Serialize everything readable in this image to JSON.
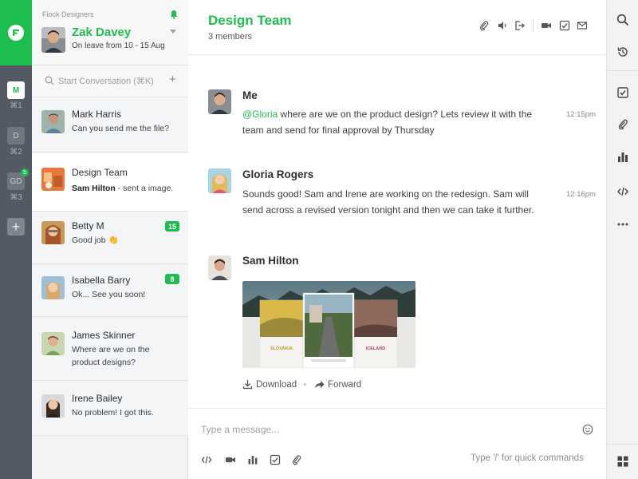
{
  "workspaces": [
    {
      "initial": "M",
      "shortcut": "⌘1"
    },
    {
      "initial": "D",
      "shortcut": "⌘2"
    },
    {
      "initial": "GD",
      "shortcut": "⌘3",
      "badge": "5"
    }
  ],
  "profile": {
    "org": "Flock Designers",
    "name": "Zak Davey",
    "status": "On leave from 10 - 15 Aug"
  },
  "search": {
    "placeholder": "Start Conversation (⌘K)"
  },
  "conversations": [
    {
      "name": "Mark Harris",
      "preview": "Can you send me the file?"
    },
    {
      "name": "Design Team",
      "preview_sender": "Sam Hilton",
      "preview": " - sent a image."
    },
    {
      "name": "Betty M",
      "preview": "Good job 👏",
      "badge": "15"
    },
    {
      "name": "Isabella Barry",
      "preview": "Ok... See you soon!",
      "badge": "8"
    },
    {
      "name": "James Skinner",
      "preview": "Where are we on the product designs?"
    },
    {
      "name": "Irene Bailey",
      "preview": "No problem! I got this."
    }
  ],
  "channel": {
    "title": "Design Team",
    "members": "3 members"
  },
  "messages": [
    {
      "sender": "Me",
      "mention": "@Gloria",
      "text": " where are we on the product design? Lets review it with the team and send for final approval by Thursday",
      "time": "12:15pm"
    },
    {
      "sender": "Gloria Rogers",
      "text": "Sounds good! Sam and Irene are working on the redesign. Sam will send across a revised version tonight and then we can take it further.",
      "time": "12:16pm"
    },
    {
      "sender": "Sam Hilton",
      "attachment": {
        "left_label": "SLOVAKIA",
        "right_label": "ICELAND"
      },
      "download_label": "Download",
      "forward_label": "Forward"
    }
  ],
  "composer": {
    "placeholder": "Type a message...",
    "hint": "Type '/' for quick commands"
  },
  "colors": {
    "accent": "#1ebd4f",
    "rail": "#535a63",
    "sidebar": "#f2f3f4"
  }
}
